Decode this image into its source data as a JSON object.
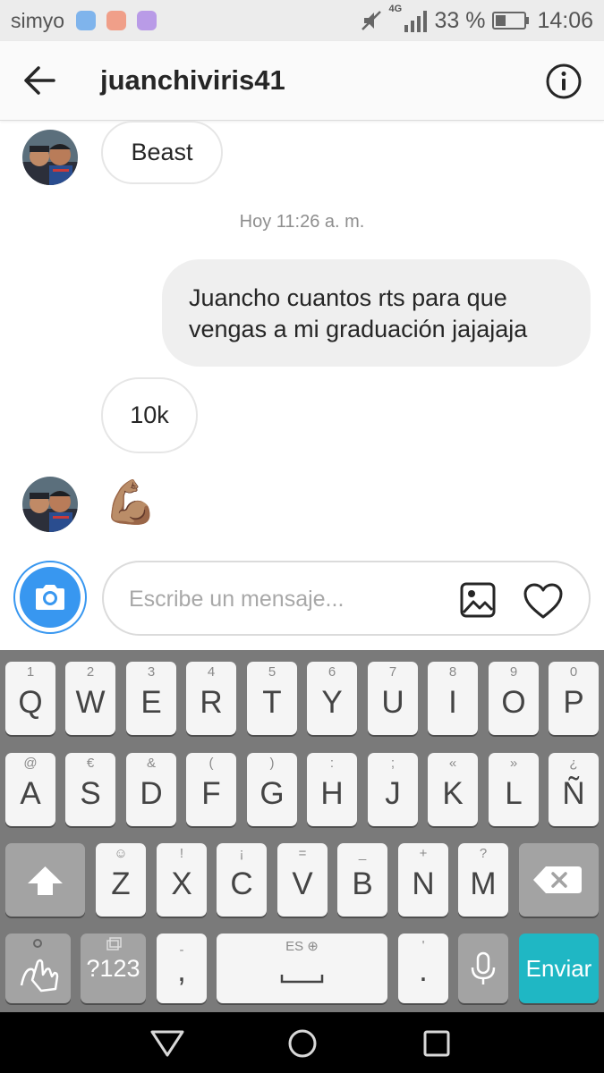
{
  "status_bar": {
    "carrier": "simyo",
    "network": "4G",
    "battery": "33 %",
    "time": "14:06",
    "notification_colors": [
      "#7fb4ec",
      "#f09f89",
      "#b99be7"
    ]
  },
  "header": {
    "username": "juanchiviris41",
    "back_icon": "arrow-left-icon",
    "info_icon": "info-circle-icon"
  },
  "messages": [
    {
      "side": "incoming",
      "text": "Beast",
      "avatar": true
    },
    {
      "side": "timestamp",
      "text": "Hoy 11:26 a. m."
    },
    {
      "side": "outgoing",
      "line1": "Juancho cuantos rts para que",
      "line2": "vengas a mi graduación jajajaja"
    },
    {
      "side": "incoming",
      "text": "10k",
      "avatar": false
    },
    {
      "side": "incoming",
      "text": "💪🏽",
      "avatar": true
    }
  ],
  "composer": {
    "placeholder": "Escribe un mensaje...",
    "camera_icon": "camera-icon",
    "gallery_icon": "image-icon",
    "like_icon": "heart-icon"
  },
  "keyboard": {
    "row1": [
      {
        "hint": "1",
        "key": "Q"
      },
      {
        "hint": "2",
        "key": "W"
      },
      {
        "hint": "3",
        "key": "E"
      },
      {
        "hint": "4",
        "key": "R"
      },
      {
        "hint": "5",
        "key": "T"
      },
      {
        "hint": "6",
        "key": "Y"
      },
      {
        "hint": "7",
        "key": "U"
      },
      {
        "hint": "8",
        "key": "I"
      },
      {
        "hint": "9",
        "key": "O"
      },
      {
        "hint": "0",
        "key": "P"
      }
    ],
    "row2": [
      {
        "hint": "@",
        "key": "A"
      },
      {
        "hint": "€",
        "key": "S"
      },
      {
        "hint": "&",
        "key": "D"
      },
      {
        "hint": "(",
        "key": "F"
      },
      {
        "hint": ")",
        "key": "G"
      },
      {
        "hint": ":",
        "key": "H"
      },
      {
        "hint": ";",
        "key": "J"
      },
      {
        "hint": "«",
        "key": "K"
      },
      {
        "hint": "»",
        "key": "L"
      },
      {
        "hint": "¿",
        "key": "Ñ"
      }
    ],
    "row3": [
      {
        "hint": "☺",
        "key": "Z"
      },
      {
        "hint": "!",
        "key": "X"
      },
      {
        "hint": "¡",
        "key": "C"
      },
      {
        "hint": "=",
        "key": "V"
      },
      {
        "hint": "_",
        "key": "B"
      },
      {
        "hint": "+",
        "key": "N"
      },
      {
        "hint": "?",
        "key": "M"
      }
    ],
    "symbols_key": "?123",
    "comma_hint": "-",
    "comma_key": ",",
    "space_label": "ES",
    "period_hint": "'",
    "period_key": ".",
    "send_key": "Enviar"
  },
  "nav_bar": {
    "back": "triangle-back-icon",
    "home": "circle-home-icon",
    "recents": "square-recents-icon"
  }
}
